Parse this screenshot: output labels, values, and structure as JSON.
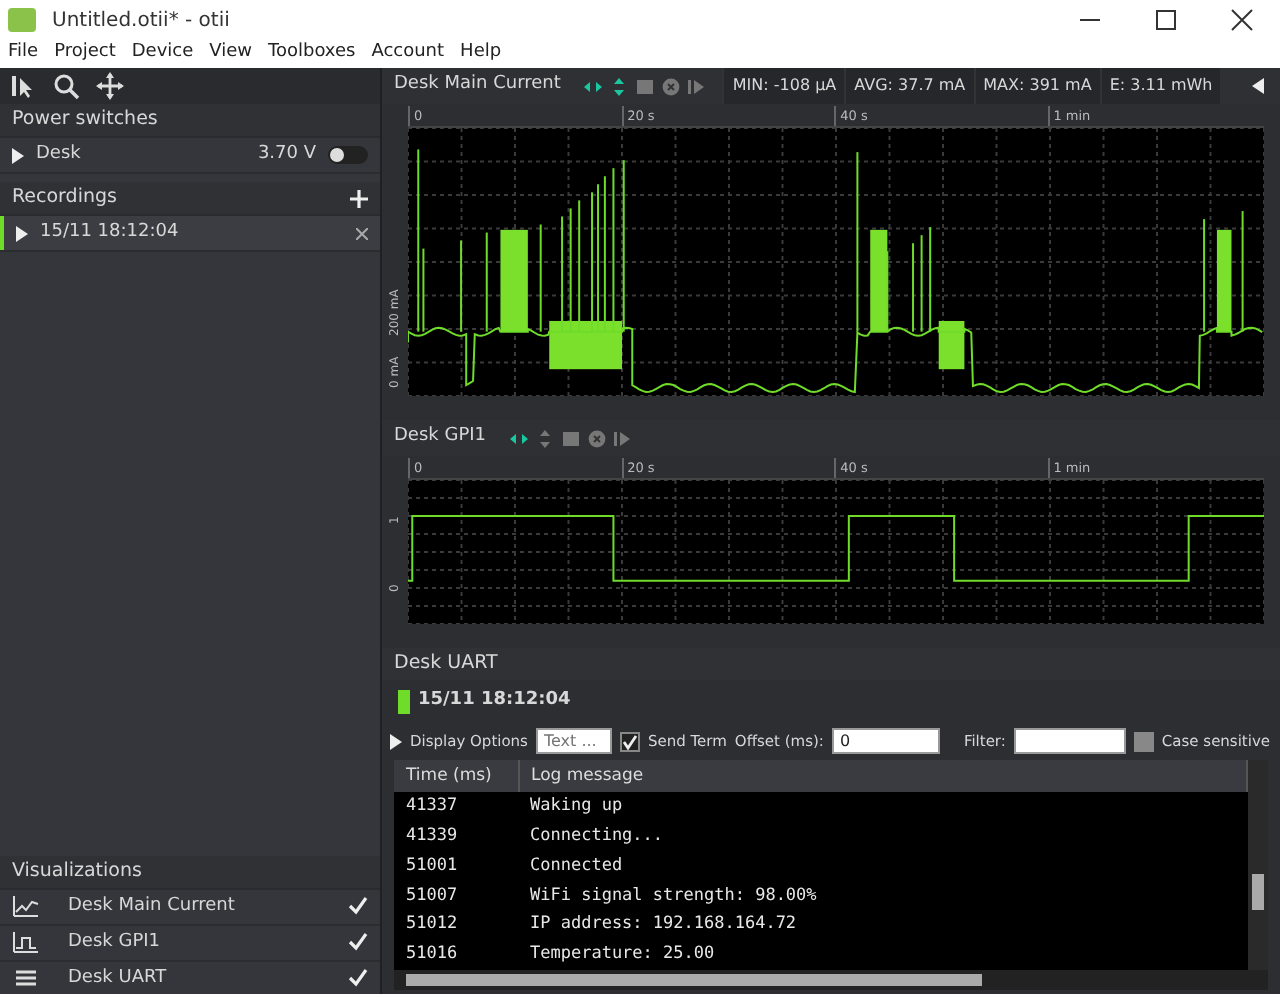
{
  "window": {
    "title": "Untitled.otii* - otii"
  },
  "menu": [
    "File",
    "Project",
    "Device",
    "View",
    "Toolboxes",
    "Account",
    "Help"
  ],
  "power_switches": {
    "title": "Power switches",
    "items": [
      {
        "label": "Desk",
        "reading": "3.70 V",
        "on": false,
        "expanded": false
      }
    ]
  },
  "recordings": {
    "title": "Recordings",
    "items": [
      {
        "label": "15/11 18:12:04",
        "selected": true,
        "expanded": false
      }
    ]
  },
  "visualizations": {
    "title": "Visualizations",
    "items": [
      {
        "label": "Desk Main Current",
        "kind": "current",
        "checked": true
      },
      {
        "label": "Desk GPI1",
        "kind": "gpi",
        "checked": true
      },
      {
        "label": "Desk UART",
        "kind": "uart",
        "checked": true
      }
    ]
  },
  "plots": [
    {
      "title": "Desk Main Current",
      "kind": "current",
      "stats": [
        "MIN: -108 µA",
        "AVG: 37.7 mA",
        "MAX: 391 mA",
        "E: 3.11 mWh"
      ],
      "xticks": [
        "0",
        "20 s",
        "40 s",
        "1 min"
      ],
      "yticks": [
        "0 mA",
        "200 mA"
      ]
    },
    {
      "title": "Desk GPI1",
      "kind": "gpi",
      "xticks": [
        "0",
        "20 s",
        "40 s",
        "1 min"
      ],
      "yticks": [
        "0",
        "1"
      ]
    }
  ],
  "uart": {
    "title": "Desk UART",
    "recording": "15/11 18:12:04",
    "options": {
      "label": "Display Options",
      "text_placeholder": "Text ...",
      "send_term": {
        "label": "Send Term",
        "checked": true
      },
      "offset_label": "Offset (ms):",
      "offset_value": "0",
      "filter_label": "Filter:",
      "case": {
        "label": "Case sensitive",
        "checked": false
      }
    },
    "columns": [
      "Time (ms)",
      "Log message"
    ],
    "rows": [
      [
        "41337",
        "Waking up"
      ],
      [
        "41339",
        "Connecting..."
      ],
      [
        "51001",
        "Connected"
      ],
      [
        "51007",
        "WiFi signal strength: 98.00%"
      ],
      [
        "51012",
        "IP address: 192.168.164.72"
      ],
      [
        "51016",
        "Temperature: 25.00"
      ]
    ]
  }
}
